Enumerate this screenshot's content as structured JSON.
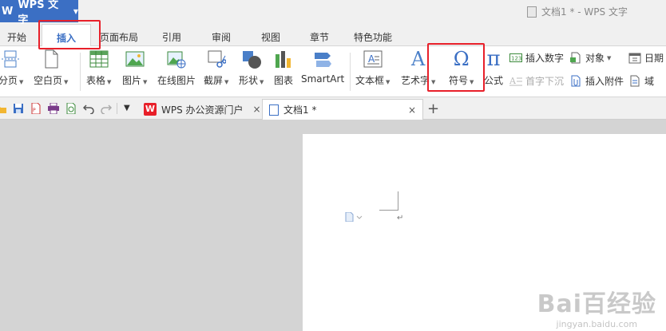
{
  "titlebar": {
    "app_name": "WPS 文字",
    "window_title": "文档1 * - WPS 文字"
  },
  "menu_tabs": [
    "开始",
    "插入",
    "页面布局",
    "引用",
    "审阅",
    "视图",
    "章节",
    "特色功能"
  ],
  "active_tab": "插入",
  "ribbon": {
    "page_break": "分页",
    "blank_page": "空白页",
    "table": "表格",
    "picture": "图片",
    "online_picture": "在线图片",
    "screenshot": "截屏",
    "shape": "形状",
    "chart": "图表",
    "smartart": "SmartArt",
    "textbox": "文本框",
    "wordart": "艺术字",
    "symbol": "符号",
    "symbol_glyph": "Ω",
    "formula": "公式",
    "formula_glyph": "π",
    "insert_number": "插入数字",
    "drop_cap": "首字下沉",
    "object": "对象",
    "insert_attachment": "插入附件",
    "date": "日期",
    "field": "域",
    "wordart_glyph": "A"
  },
  "doc_tabs": {
    "tab1": "WPS 办公资源门户",
    "tab2": "文档1 *",
    "close": "×",
    "plus": "+"
  },
  "watermark": {
    "line1": "Bai百经验",
    "line2": "jingyan.baidu.com"
  },
  "colors": {
    "accent": "#3b6fc4",
    "highlight": "#e8202a"
  }
}
